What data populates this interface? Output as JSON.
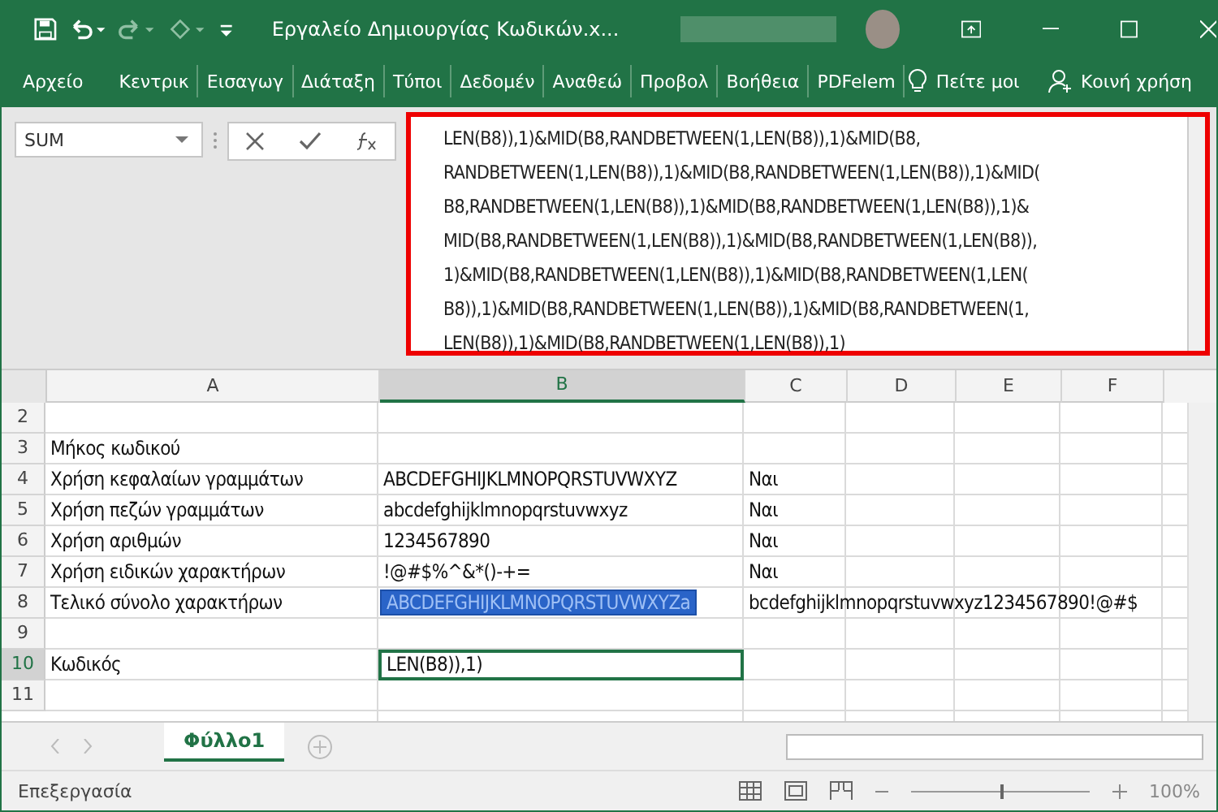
{
  "window": {
    "title": "Εργαλείο Δημιουργίας Κωδικών.x..."
  },
  "ribbon_tabs": [
    {
      "label": "Αρχείο",
      "selected": false
    },
    {
      "label": "Κεντρικ",
      "selected": false
    },
    {
      "label": "Εισαγωγ",
      "selected": false
    },
    {
      "label": "Διάταξη",
      "selected": false
    },
    {
      "label": "Τύποι",
      "selected": false
    },
    {
      "label": "Δεδομέν",
      "selected": false
    },
    {
      "label": "Αναθεώ",
      "selected": false
    },
    {
      "label": "Προβολ",
      "selected": false
    },
    {
      "label": "Βοήθεια",
      "selected": false
    },
    {
      "label": "PDFelem",
      "selected": false
    }
  ],
  "tell_me": "Πείτε μοι",
  "share": "Κοινή χρήση",
  "name_box": "SUM",
  "formula_lines": [
    "LEN(B8)),1)&MID(B8,RANDBETWEEN(1,LEN(B8)),1)&MID(B8,",
    "RANDBETWEEN(1,LEN(B8)),1)&MID(B8,RANDBETWEEN(1,LEN(B8)),1)&MID(",
    "B8,RANDBETWEEN(1,LEN(B8)),1)&MID(B8,RANDBETWEEN(1,LEN(B8)),1)&",
    "MID(B8,RANDBETWEEN(1,LEN(B8)),1)&MID(B8,RANDBETWEEN(1,LEN(B8)),",
    "1)&MID(B8,RANDBETWEEN(1,LEN(B8)),1)&MID(B8,RANDBETWEEN(1,LEN(",
    "B8)),1)&MID(B8,RANDBETWEEN(1,LEN(B8)),1)&MID(B8,RANDBETWEEN(1,",
    "LEN(B8)),1)&MID(B8,RANDBETWEEN(1,LEN(B8)),1)"
  ],
  "columns": [
    {
      "label": "A",
      "selected": false
    },
    {
      "label": "B",
      "selected": true
    },
    {
      "label": "C",
      "selected": false
    },
    {
      "label": "D",
      "selected": false
    },
    {
      "label": "E",
      "selected": false
    },
    {
      "label": "F",
      "selected": false
    }
  ],
  "rows": [
    {
      "number": "2",
      "selected": false,
      "cells": []
    },
    {
      "number": "3",
      "selected": false,
      "cells": [
        {
          "text": "Μήκος κωδικού",
          "selected": false,
          "active": false
        }
      ]
    },
    {
      "number": "4",
      "selected": false,
      "cells": [
        {
          "text": "Χρήση κεφαλαίων γραμμάτων",
          "selected": false,
          "active": false
        },
        {
          "text": "ABCDEFGHIJKLMNOPQRSTUVWXYZ",
          "selected": false,
          "active": false
        },
        {
          "text": "Ναι",
          "selected": false,
          "active": false
        }
      ]
    },
    {
      "number": "5",
      "selected": false,
      "cells": [
        {
          "text": "Χρήση πεζών γραμμάτων",
          "selected": false,
          "active": false
        },
        {
          "text": "abcdefghijklmnopqrstuvwxyz",
          "selected": false,
          "active": false
        },
        {
          "text": "Ναι",
          "selected": false,
          "active": false
        }
      ]
    },
    {
      "number": "6",
      "selected": false,
      "cells": [
        {
          "text": "Χρήση αριθμών",
          "selected": false,
          "active": false
        },
        {
          "text": "1234567890",
          "selected": false,
          "active": false
        },
        {
          "text": "Ναι",
          "selected": false,
          "active": false
        }
      ]
    },
    {
      "number": "7",
      "selected": false,
      "cells": [
        {
          "text": "Χρήση ειδικών χαρακτήρων",
          "selected": false,
          "active": false
        },
        {
          "text": "!@#$%^&*()-+=",
          "selected": false,
          "active": false
        },
        {
          "text": "Ναι",
          "selected": false,
          "active": false
        }
      ]
    },
    {
      "number": "8",
      "selected": false,
      "cells": [
        {
          "text": "Τελικό σύνολο χαρακτήρων",
          "selected": false,
          "active": false
        },
        {
          "text": "ABCDEFGHIJKLMNOPQRSTUVWXYZa",
          "selected": true,
          "active": false
        },
        {
          "text": "bcdefghijklmnopqrstuvwxyz1234567890!@#$",
          "selected": false,
          "active": false
        }
      ]
    },
    {
      "number": "9",
      "selected": false,
      "cells": []
    },
    {
      "number": "10",
      "selected": true,
      "cells": [
        {
          "text": "Κωδικός",
          "selected": false,
          "active": false
        },
        {
          "text": "LEN(B8)),1)",
          "selected": false,
          "active": true
        }
      ]
    },
    {
      "number": "11",
      "selected": false,
      "cells": []
    }
  ],
  "sheet_tabs": [
    {
      "label": "Φύλλο1",
      "selected": true
    }
  ],
  "status_bar": {
    "mode": "Επεξεργασία",
    "zoom": "100%",
    "zoom_slider": {
      "level": 0.5
    }
  }
}
